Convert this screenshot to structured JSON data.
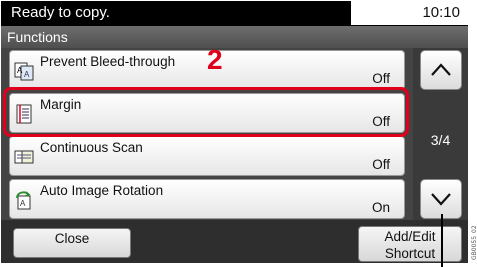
{
  "status": {
    "text": "Ready to copy.",
    "time": "10:10"
  },
  "screen_title": "Functions",
  "step_number": "2",
  "rows": [
    {
      "label": "Prevent Bleed-through",
      "value": "Off",
      "icon": "prevent-bleed-through-icon"
    },
    {
      "label": "Margin",
      "value": "Off",
      "icon": "margin-icon"
    },
    {
      "label": "Continuous Scan",
      "value": "Off",
      "icon": "continuous-scan-icon"
    },
    {
      "label": "Auto Image Rotation",
      "value": "On",
      "icon": "auto-image-rotation-icon"
    }
  ],
  "page_indicator": "3/4",
  "buttons": {
    "close": "Close",
    "add_edit_line1": "Add/Edit",
    "add_edit_line2": "Shortcut"
  },
  "side_ref": "GB0055_02",
  "colors": {
    "highlight": "#e0001b",
    "screen_bg": "#000000"
  }
}
